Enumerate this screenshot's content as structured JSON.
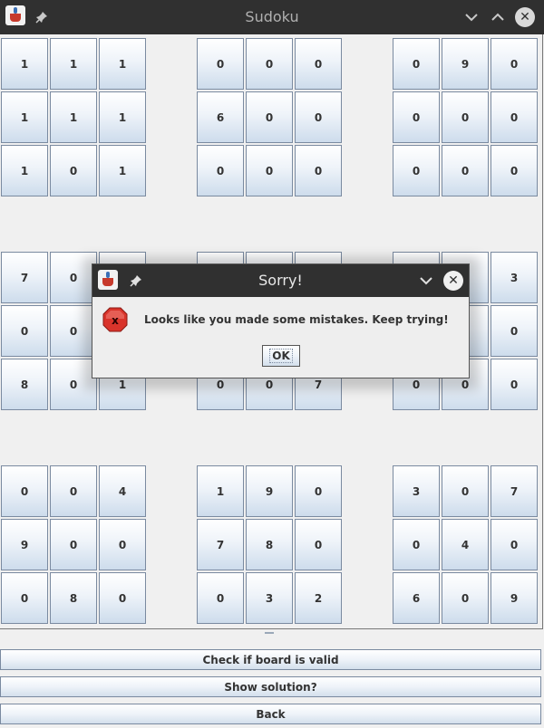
{
  "window": {
    "title": "Sudoku"
  },
  "board": {
    "grid": [
      [
        "1",
        "1",
        "1",
        "0",
        "0",
        "0",
        "0",
        "9",
        "0"
      ],
      [
        "1",
        "1",
        "1",
        "6",
        "0",
        "0",
        "0",
        "0",
        "0"
      ],
      [
        "1",
        "0",
        "1",
        "0",
        "0",
        "0",
        "0",
        "0",
        "0"
      ],
      [
        "7",
        "0",
        "",
        "",
        "",
        "",
        "",
        "",
        "3"
      ],
      [
        "0",
        "0",
        "",
        "",
        "",
        "",
        "",
        "",
        "0"
      ],
      [
        "8",
        "0",
        "1",
        "0",
        "0",
        "7",
        "0",
        "0",
        "0"
      ],
      [
        "0",
        "0",
        "4",
        "1",
        "9",
        "0",
        "3",
        "0",
        "7"
      ],
      [
        "9",
        "0",
        "0",
        "7",
        "8",
        "0",
        "0",
        "4",
        "0"
      ],
      [
        "0",
        "8",
        "0",
        "0",
        "3",
        "2",
        "6",
        "0",
        "9"
      ]
    ]
  },
  "buttons": {
    "check": "Check if board is valid",
    "solution": "Show solution?",
    "back": "Back"
  },
  "dialog": {
    "title": "Sorry!",
    "message": "Looks like you made some mistakes. Keep trying!",
    "ok_label": "OK"
  },
  "icons": {
    "app": "java-duke-icon",
    "pin": "pin-icon",
    "minimize": "chevron-down-icon",
    "maximize": "chevron-up-icon",
    "close": "close-icon",
    "error": "error-icon"
  },
  "colors": {
    "titlebar": "#303030",
    "cell_border": "#7a8aa0",
    "error_red": "#d9342b"
  }
}
